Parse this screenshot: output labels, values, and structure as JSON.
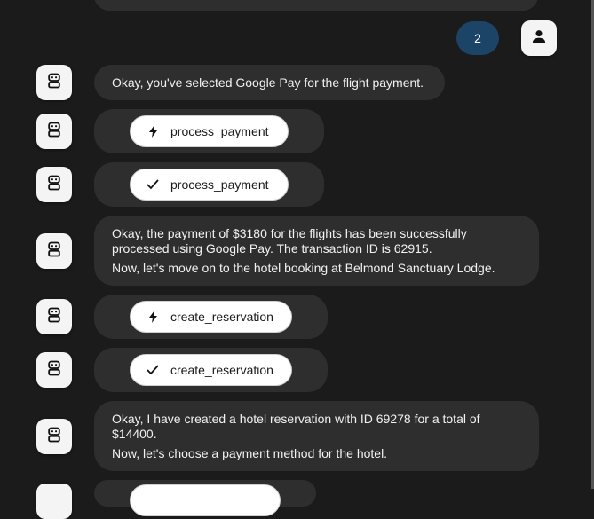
{
  "user_turn": {
    "badge": "2"
  },
  "messages": [
    {
      "kind": "text",
      "lines": [
        "Okay, you've selected Google Pay for the flight payment."
      ]
    },
    {
      "kind": "tool_call",
      "tool": "process_payment",
      "icon": "lightning-icon"
    },
    {
      "kind": "tool_result",
      "tool": "process_payment",
      "icon": "checkmark-icon"
    },
    {
      "kind": "text",
      "lines": [
        "Okay, the payment of $3180 for the flights has been successfully processed using Google Pay. The transaction ID is 62915.",
        "Now, let's move on to the hotel booking at Belmond Sanctuary Lodge."
      ]
    },
    {
      "kind": "tool_call",
      "tool": "create_reservation",
      "icon": "lightning-icon"
    },
    {
      "kind": "tool_result",
      "tool": "create_reservation",
      "icon": "checkmark-icon"
    },
    {
      "kind": "text",
      "lines": [
        "Okay, I have created a hotel reservation with ID 69278 for a total of $14400.",
        "Now, let's choose a payment method for the hotel."
      ]
    }
  ],
  "colors": {
    "background": "#1b1b1b",
    "bubble": "#2e2e2e",
    "badge": "#1c4466",
    "pill": "#ffffff"
  }
}
